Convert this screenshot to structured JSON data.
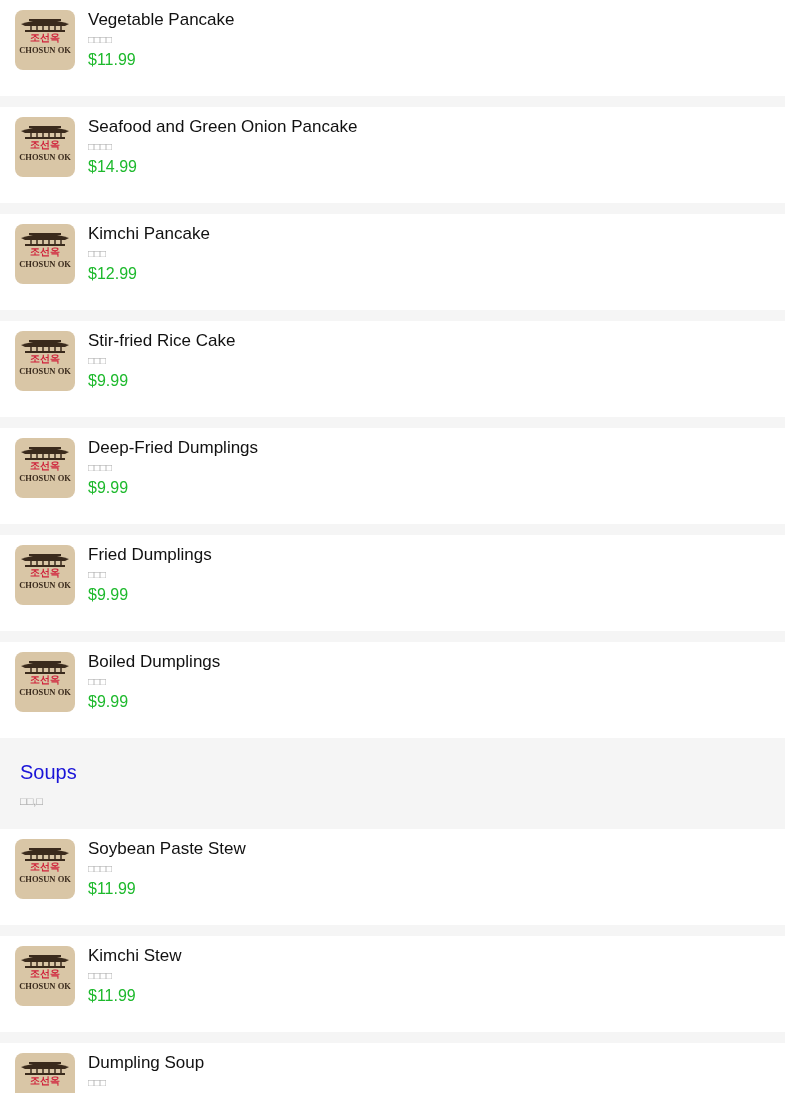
{
  "sections": [
    {
      "kind": "items",
      "items": [
        {
          "name": "Vegetable Pancake",
          "subtitle": "□□□□",
          "price": "$11.99",
          "logo": [
            "조선옥",
            "CHOSUN OK"
          ]
        },
        {
          "name": "Seafood and Green Onion Pancake",
          "subtitle": "□□□□",
          "price": "$14.99",
          "logo": [
            "조선옥",
            "CHOSUN OK"
          ]
        },
        {
          "name": "Kimchi Pancake",
          "subtitle": "□□□",
          "price": "$12.99",
          "logo": [
            "조선옥",
            "CHOSUN OK"
          ]
        },
        {
          "name": "Stir-fried Rice Cake",
          "subtitle": "□□□",
          "price": "$9.99",
          "logo": [
            "조선옥",
            "CHOSUN OK"
          ]
        },
        {
          "name": "Deep-Fried Dumplings",
          "subtitle": "□□□□",
          "price": "$9.99",
          "logo": [
            "조선옥",
            "CHOSUN OK"
          ]
        },
        {
          "name": "Fried Dumplings",
          "subtitle": "□□□",
          "price": "$9.99",
          "logo": [
            "조선옥",
            "CHOSUN OK"
          ]
        },
        {
          "name": "Boiled Dumplings",
          "subtitle": "□□□",
          "price": "$9.99",
          "logo": [
            "조선옥",
            "CHOSUN OK"
          ]
        }
      ]
    },
    {
      "kind": "header",
      "title": "Soups",
      "subtitle": "□□,□"
    },
    {
      "kind": "items",
      "items": [
        {
          "name": "Soybean Paste Stew",
          "subtitle": "□□□□",
          "price": "$11.99",
          "logo": [
            "조선옥",
            "CHOSUN OK"
          ]
        },
        {
          "name": "Kimchi Stew",
          "subtitle": "□□□□",
          "price": "$11.99",
          "logo": [
            "조선옥",
            "CHOSUN OK"
          ]
        },
        {
          "name": "Dumpling Soup",
          "subtitle": "□□□",
          "logo": [
            "조선옥"
          ]
        }
      ]
    }
  ]
}
